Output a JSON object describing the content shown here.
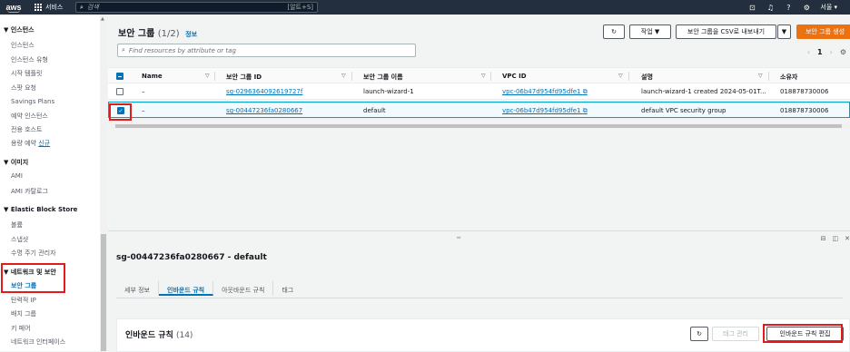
{
  "topnav": {
    "logo": "aws",
    "services_label": "서비스",
    "search_placeholder": "검색",
    "search_shortcut": "[알트+S]",
    "region": "서울 ▾"
  },
  "sidebar": {
    "sections": [
      {
        "title": "▼ 인스턴스",
        "items": [
          "인스턴스",
          "인스턴스 유형",
          "시작 템플릿",
          "스팟 요청",
          "Savings Plans",
          "예약 인스턴스",
          "전용 호스트",
          "용량 예약"
        ],
        "new_badge": "신규"
      },
      {
        "title": "▼ 이미지",
        "items": [
          "AMI",
          "AMI 카탈로그"
        ]
      },
      {
        "title": "▼ Elastic Block Store",
        "items": [
          "볼륨",
          "스냅샷",
          "수명 주기 관리자"
        ]
      },
      {
        "title": "▼ 네트워크 및 보안",
        "items": [
          "보안 그룹",
          "탄력적 IP",
          "배치 그룹",
          "키 페어",
          "네트워크 인터페이스"
        ]
      }
    ]
  },
  "header": {
    "title": "보안 그룹",
    "count": "(1/2)",
    "info": "정보",
    "actions_label": "작업 ▼",
    "export_label": "보안 그룹을 CSV로 내보내기",
    "create_label": "보안 그룹 생성",
    "filter_placeholder": "Find resources by attribute or tag",
    "page": "1"
  },
  "table": {
    "columns": [
      "Name",
      "보안 그룹 ID",
      "보안 그룹 이름",
      "VPC ID",
      "설명",
      "소유자"
    ],
    "rows": [
      {
        "name": "–",
        "sg_id": "sg-0296364092619727f",
        "sg_name": "launch-wizard-1",
        "vpc_id": "vpc-06b47d954fd95dfe1",
        "desc": "launch-wizard-1 created 2024-05-01T...",
        "owner": "018878730006",
        "selected": false
      },
      {
        "name": "–",
        "sg_id": "sg-00447236fa0280667",
        "sg_name": "default",
        "vpc_id": "vpc-06b47d954fd95dfe1",
        "desc": "default VPC security group",
        "owner": "018878730006",
        "selected": true
      }
    ]
  },
  "detail": {
    "title": "sg-00447236fa0280667 - default",
    "tabs": [
      "세부 정보",
      "인바운드 규칙",
      "아웃바운드 규칙",
      "태그"
    ],
    "panel_title": "인바운드 규칙",
    "panel_count": "(14)",
    "manage_tags": "태그 관리",
    "edit_inbound": "인바운드 규칙 편집"
  },
  "colors": {
    "accent": "#0073bb",
    "primary": "#ec7211",
    "highlight": "#e41b1b",
    "nav": "#232f3e"
  }
}
